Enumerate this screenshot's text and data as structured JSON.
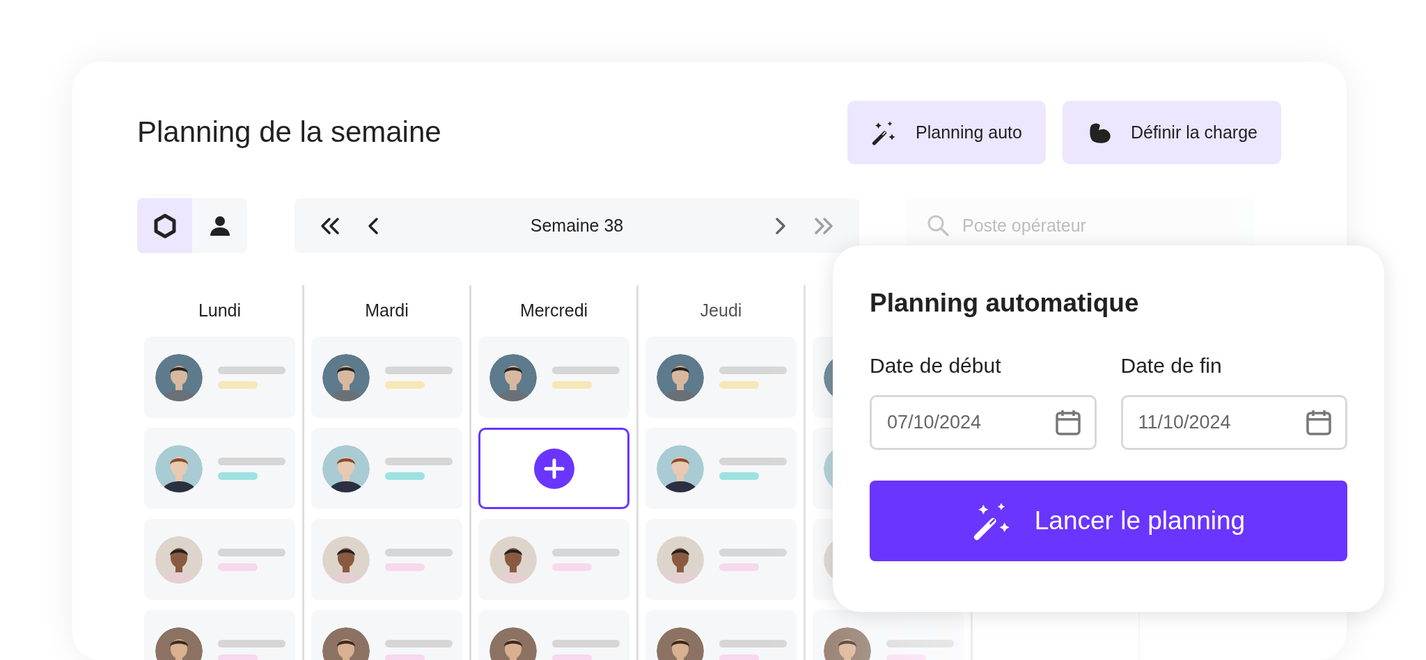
{
  "header": {
    "title": "Planning de la semaine",
    "actions": [
      {
        "kind": "wand",
        "label": "Planning auto"
      },
      {
        "kind": "muscle",
        "label": "Définir la charge"
      }
    ]
  },
  "view_toggle": [
    {
      "kind": "hexagon",
      "selected": true
    },
    {
      "kind": "person",
      "selected": false
    }
  ],
  "week_nav": {
    "label": "Semaine 38"
  },
  "search": {
    "placeholder": "Poste opérateur"
  },
  "days": [
    {
      "label": "Lundi",
      "slots": [
        {
          "kind": "person",
          "color": "#f8e7b6"
        },
        {
          "kind": "person",
          "color": "#9de2e2"
        },
        {
          "kind": "person",
          "color": "#f8d8ee"
        },
        {
          "kind": "person",
          "color": "#f8d8ee"
        }
      ]
    },
    {
      "label": "Mardi",
      "slots": [
        {
          "kind": "person",
          "color": "#f8e7b6"
        },
        {
          "kind": "person",
          "color": "#9de2e2"
        },
        {
          "kind": "person",
          "color": "#f8d8ee"
        },
        {
          "kind": "person",
          "color": "#f8d8ee"
        }
      ]
    },
    {
      "label": "Mercredi",
      "slots": [
        {
          "kind": "person",
          "color": "#f8e7b6"
        },
        {
          "kind": "add"
        },
        {
          "kind": "person",
          "color": "#f8d8ee"
        },
        {
          "kind": "person",
          "color": "#f8d8ee"
        }
      ]
    },
    {
      "label": "Jeudi",
      "slots": [
        {
          "kind": "person",
          "color": "#f8e7b6"
        },
        {
          "kind": "person",
          "color": "#9de2e2"
        },
        {
          "kind": "person",
          "color": "#f8d8ee"
        },
        {
          "kind": "person",
          "color": "#f8d8ee"
        }
      ]
    },
    {
      "slots": [
        {
          "kind": "person"
        },
        {
          "kind": "person"
        },
        {
          "kind": "person"
        },
        {
          "kind": "person",
          "color": "#f8d8ee"
        }
      ]
    }
  ],
  "dialog": {
    "title": "Planning automatique",
    "fields": [
      {
        "label": "Date de début",
        "value": "07/10/2024"
      },
      {
        "label": "Date de fin",
        "value": "11/10/2024"
      }
    ],
    "button": "Lancer le planning"
  }
}
